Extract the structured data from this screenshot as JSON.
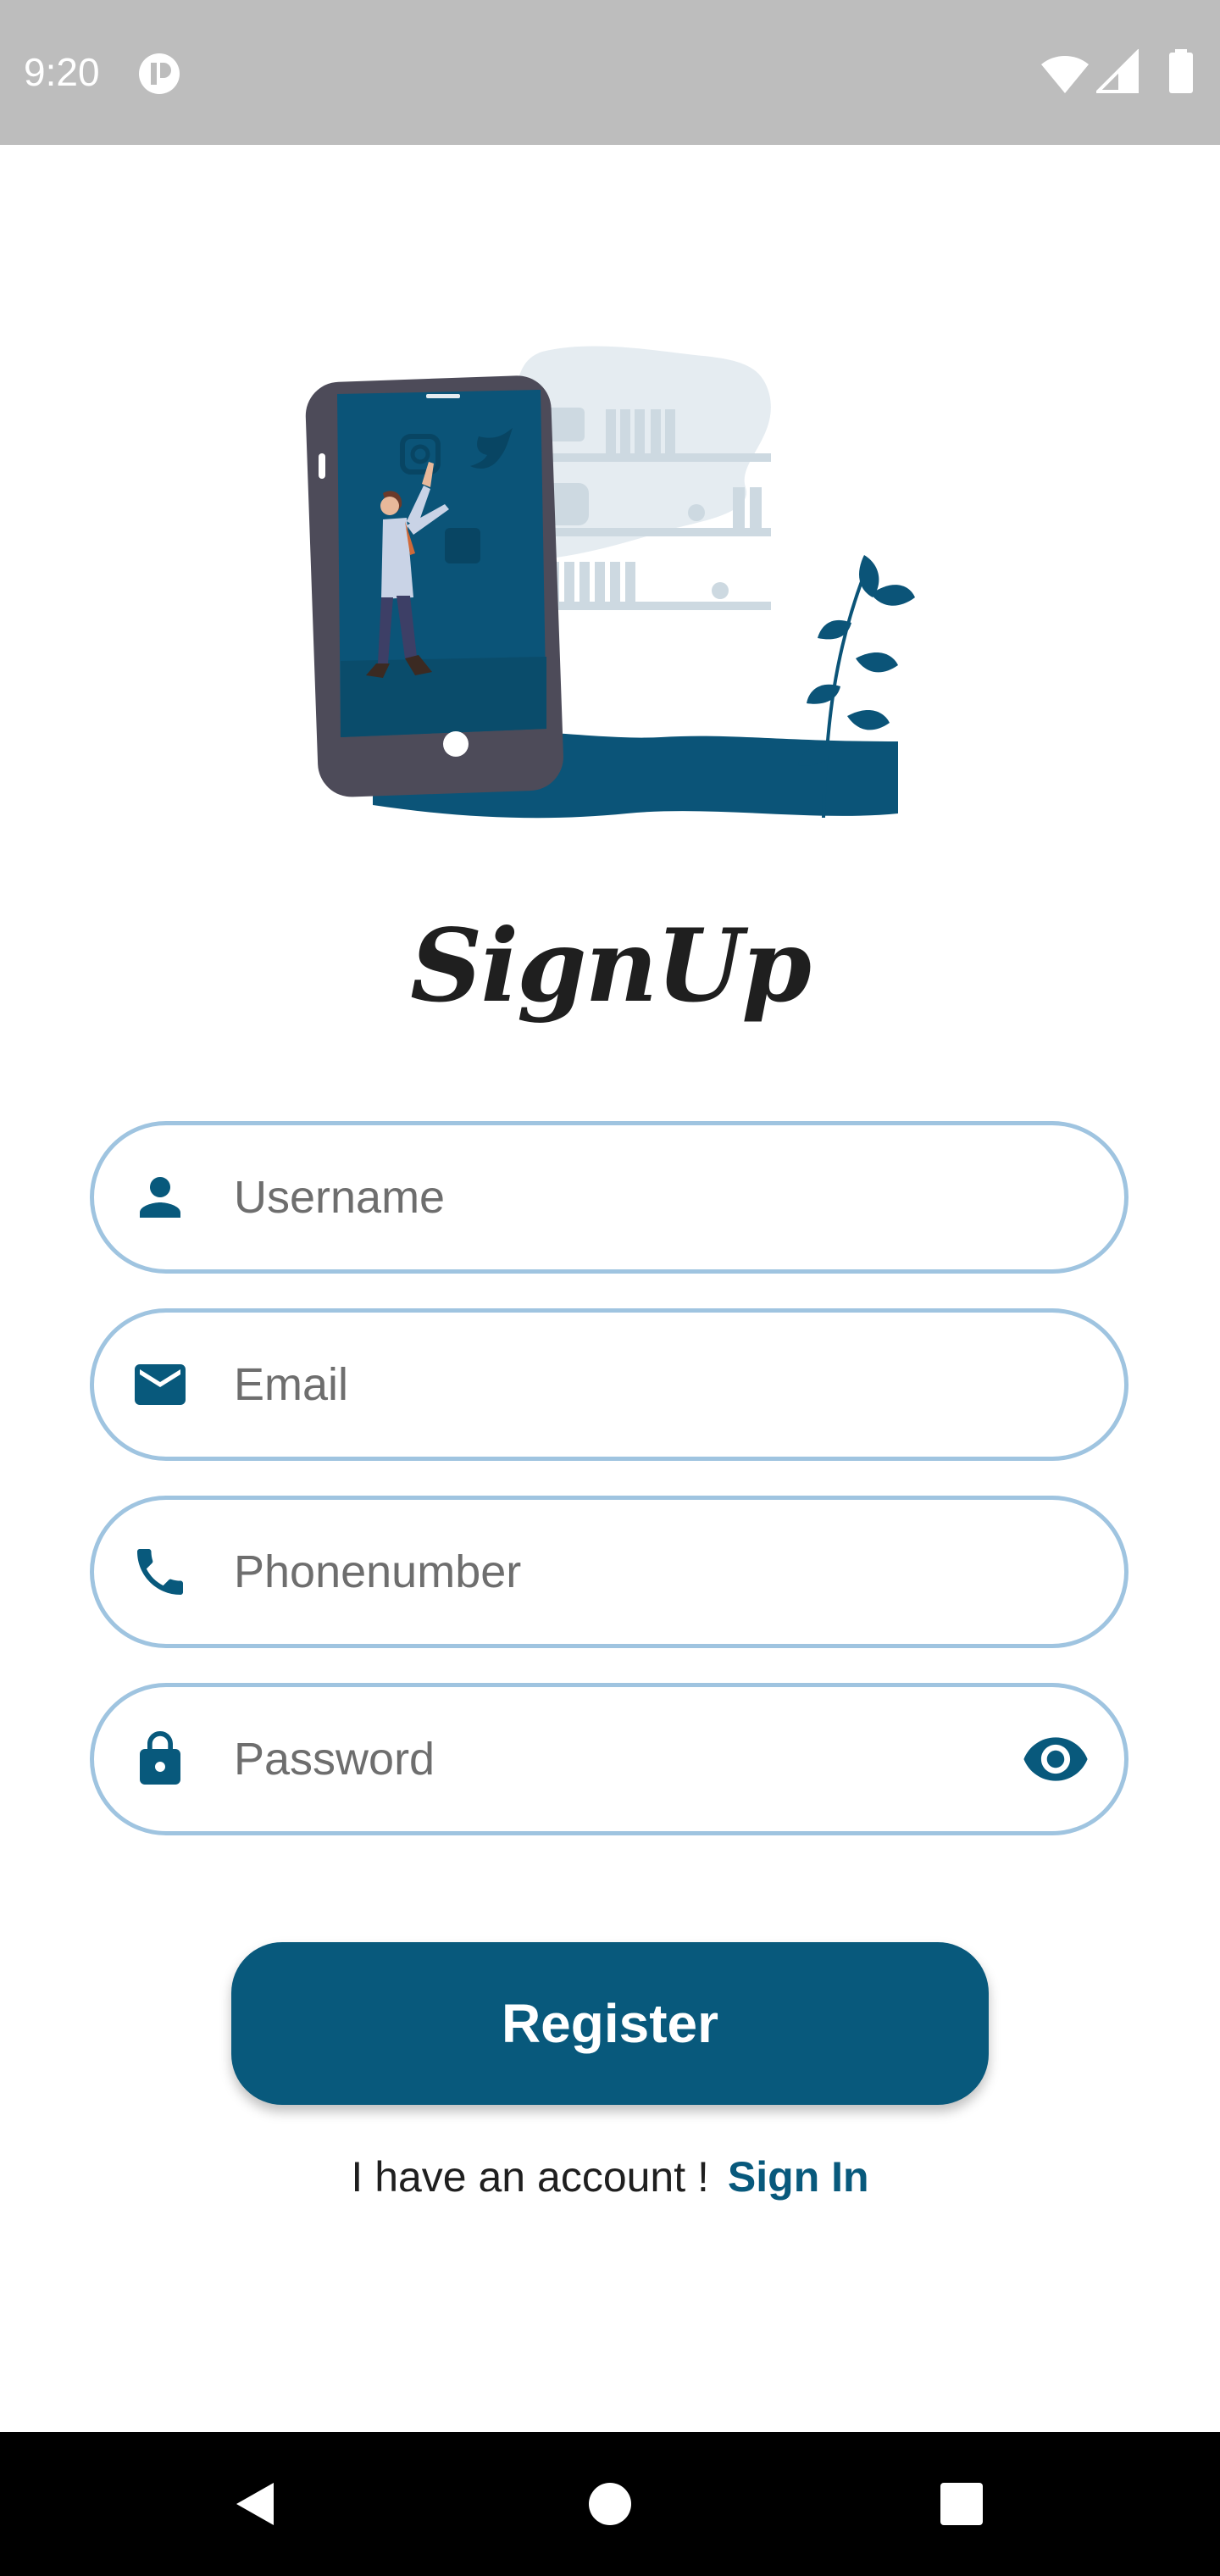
{
  "status_bar": {
    "time": "9:20",
    "icons": [
      "app-notification-icon",
      "wifi-icon",
      "cell-signal-icon",
      "battery-icon"
    ]
  },
  "illustration": {
    "name": "social-media-phone-illustration"
  },
  "title": "SignUp",
  "form": {
    "username": {
      "placeholder": "Username",
      "value": "",
      "icon": "person-icon"
    },
    "email": {
      "placeholder": "Email",
      "value": "",
      "icon": "mail-icon"
    },
    "phone": {
      "placeholder": "Phonenumber",
      "value": "",
      "icon": "phone-icon"
    },
    "password": {
      "placeholder": "Password",
      "value": "",
      "icon": "lock-icon",
      "toggle_icon": "eye-icon"
    }
  },
  "register_label": "Register",
  "signin": {
    "prompt": "I have an account !",
    "link_label": "Sign In"
  },
  "colors": {
    "accent": "#08597c",
    "field_border": "#9fc4e0",
    "status_bar": "#bdbdbd",
    "nav_bar": "#000000"
  },
  "nav": {
    "buttons": [
      "back-icon",
      "home-icon",
      "recents-icon"
    ]
  }
}
